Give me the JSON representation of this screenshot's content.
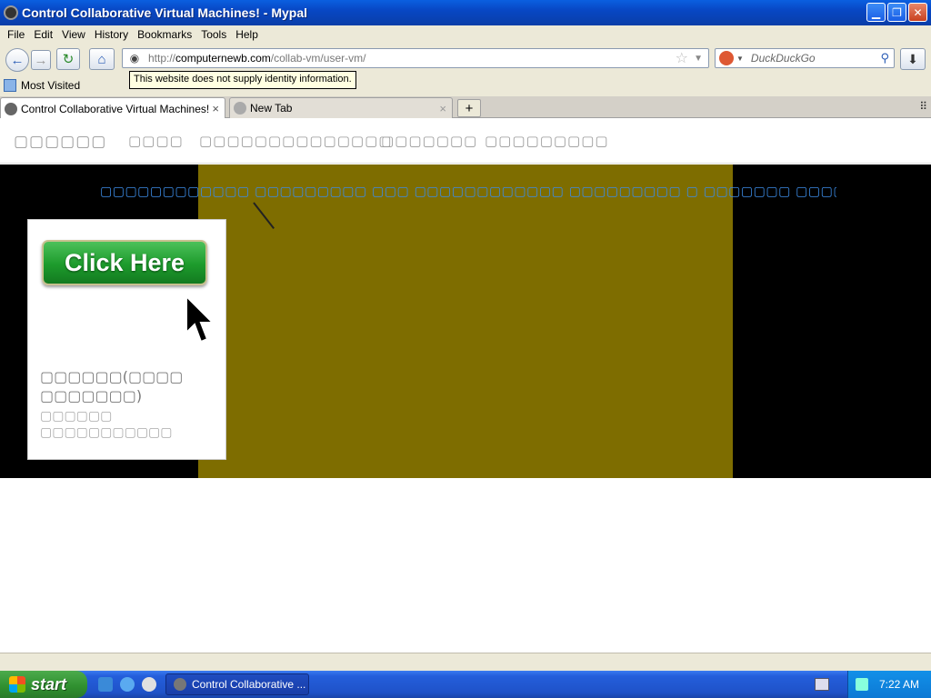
{
  "window": {
    "title": "Control Collaborative Virtual Machines! - Mypal",
    "minimize": "▁",
    "restore": "❐",
    "close": "✕"
  },
  "menu": {
    "items": [
      "File",
      "Edit",
      "View",
      "History",
      "Bookmarks",
      "Tools",
      "Help"
    ]
  },
  "nav": {
    "back_icon": "←",
    "forward_icon": "→",
    "reload_icon": "↻",
    "home_icon": "⌂",
    "url_prefix": "http://",
    "url_domain": "computernewb.com",
    "url_path": "/collab-vm/user-vm/",
    "search_placeholder": "DuckDuckGo",
    "download_icon": "⬇"
  },
  "tooltip": "This website does not supply identity information.",
  "bookmarks": {
    "most_visited": "Most Visited"
  },
  "tabs": {
    "active": "Control Collaborative Virtual Machines!",
    "inactive": "New Tab",
    "close": "×",
    "new_tab": "+",
    "list_all": "⠿"
  },
  "page": {
    "nav_items": [
      "▢▢▢▢▢▢",
      "▢▢▢▢",
      "▢▢▢▢▢▢▢▢▢▢▢▢▢▢",
      "▢▢▢▢▢▢▢",
      "▢▢▢▢▢▢▢▢▢"
    ],
    "headline": "▢▢▢▢▢▢▢▢▢▢▢▢ ▢▢▢▢▢▢▢▢▢ ▢▢▢ ▢▢▢▢▢▢▢▢▢▢▢▢ ▢▢▢▢▢▢▢▢▢ ▢ ▢▢▢▢▢▢▢ ▢▢▢▢▢▢▢",
    "card": {
      "button": "Click Here",
      "title": "▢▢▢▢▢▢(▢▢▢▢ ▢▢▢▢▢▢▢)",
      "subtitle": "▢▢▢▢▢▢ ▢▢▢▢▢▢▢▢▢▢▢"
    }
  },
  "taskbar": {
    "start": "start",
    "window_item": "Control Collaborative ...",
    "clock": "7:22 AM"
  }
}
